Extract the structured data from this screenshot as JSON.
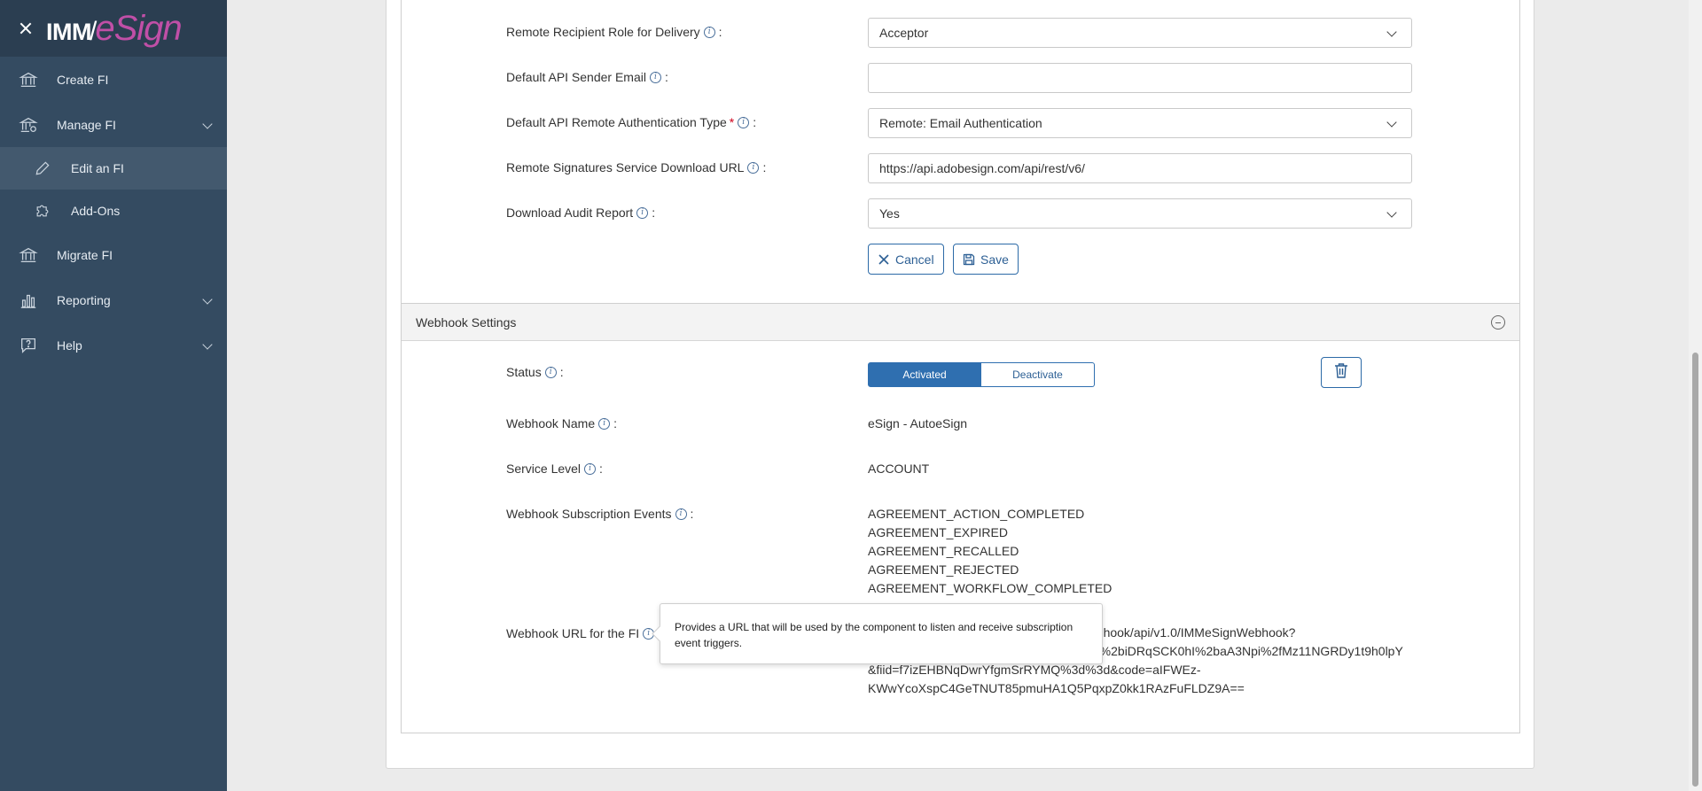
{
  "sidebar": {
    "logo": {
      "part1": "IMM",
      "slash": "/",
      "part2": "eSign"
    },
    "items": [
      {
        "label": "Create FI",
        "icon": "bank-icon"
      },
      {
        "label": "Manage FI",
        "icon": "bank-settings-icon",
        "expanded": true
      },
      {
        "label": "Edit an FI",
        "icon": "pencil-icon",
        "sub": true,
        "active": true
      },
      {
        "label": "Add-Ons",
        "icon": "puzzle-icon",
        "sub": true
      },
      {
        "label": "Migrate FI",
        "icon": "bank-migrate-icon"
      },
      {
        "label": "Reporting",
        "icon": "bar-chart-icon"
      },
      {
        "label": "Help",
        "icon": "help-bubble-icon"
      }
    ]
  },
  "form": {
    "recipient_role": {
      "label": "Remote Recipient Role for Delivery",
      "value": "Acceptor"
    },
    "sender_email": {
      "label": "Default API Sender Email",
      "value": ""
    },
    "auth_type": {
      "label": "Default API Remote Authentication Type",
      "required_mark": "*",
      "value": "Remote: Email Authentication"
    },
    "download_url": {
      "label": "Remote Signatures Service Download URL",
      "value": "https://api.adobesign.com/api/rest/v6/"
    },
    "audit_report": {
      "label": "Download Audit Report",
      "value": "Yes"
    },
    "colon": ":",
    "info_glyph": "i",
    "cancel_label": "Cancel",
    "save_label": "Save"
  },
  "webhook": {
    "header": "Webhook Settings",
    "status_label": "Status",
    "activated_label": "Activated",
    "deactivate_label": "Deactivate",
    "name_label": "Webhook Name",
    "name_value": "eSign - AutoeSign",
    "service_level_label": "Service Level",
    "service_level_value": "ACCOUNT",
    "events_label": "Webhook Subscription Events",
    "events": [
      "AGREEMENT_ACTION_COMPLETED",
      "AGREEMENT_EXPIRED",
      "AGREEMENT_RECALLED",
      "AGREEMENT_REJECTED",
      "AGREEMENT_WORKFLOW_COMPLETED"
    ],
    "url_label": "Webhook URL for the FI",
    "url_lines": [
      "ebhook/api/v1.0/IMMeSignWebhook?",
      "2f%2biDRqSCK0hI%2baA3Npi%2fMz11NGRDy1t9h0lpY",
      "&fiid=f7izEHBNqDwrYfgmSrRYMQ%3d%3d&code=aIFWEz-",
      "KWwYcoXspC4GeTNUT85pmuHA1Q5PqxpZ0kk1RAzFuFLDZ9A=="
    ],
    "tooltip": "Provides a URL that will be used by the component to listen and receive subscription event triggers."
  },
  "colors": {
    "sidebar_bg": "#344b61",
    "brand_bg": "#2b3e51",
    "accent": "#2f6fb0",
    "logo_accent": "#c04fa7",
    "required": "#d0021b"
  }
}
